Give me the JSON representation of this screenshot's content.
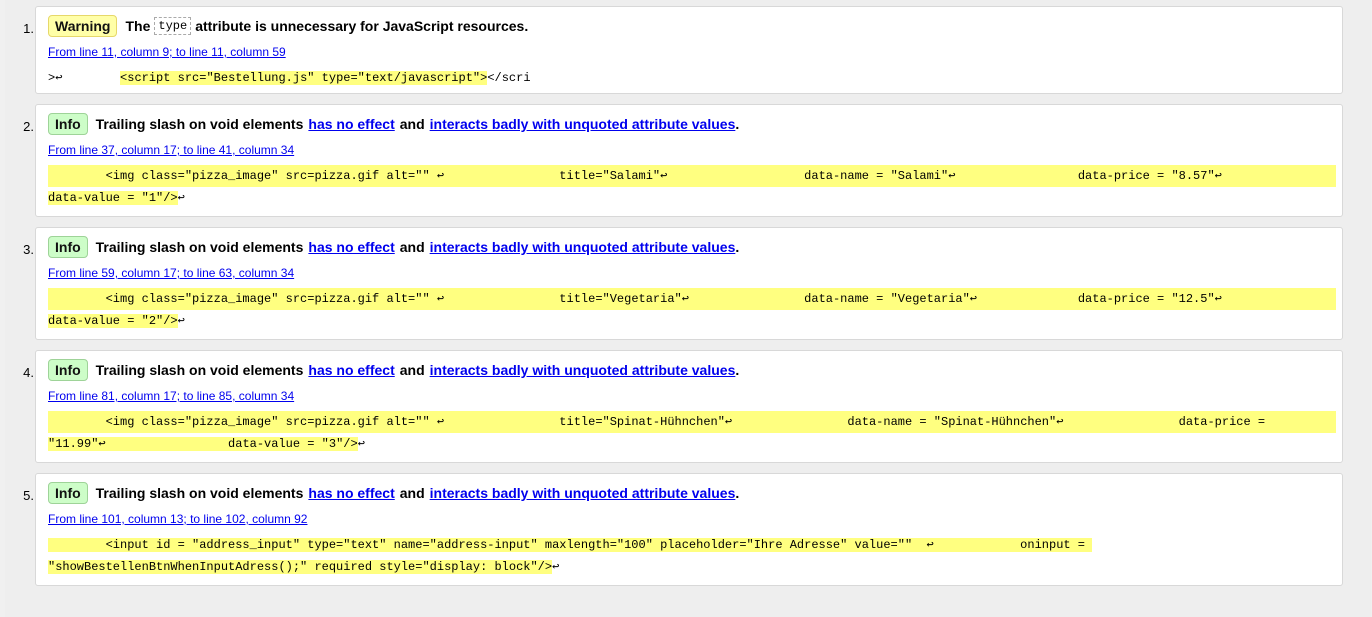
{
  "messages": [
    {
      "num": "1.",
      "type": "Warning",
      "text_before": "The",
      "code": "type",
      "text_after": "attribute is unnecessary for JavaScript resources.",
      "location": "From line 11, column 9; to line 11, column 59",
      "line1_pre": ">↩",
      "line1_hl": "<script src=\"Bestellung.js\" type=\"text/javascript\">",
      "line1_post": "</scri",
      "line2_hl": "",
      "line2_post": ""
    },
    {
      "num": "2.",
      "type": "Info",
      "text_before": "Trailing slash on void elements",
      "link1": "has no effect",
      "middle": "and",
      "link2": "interacts badly with unquoted attribute values",
      "end": ".",
      "location": "From line 37, column 17; to line 41, column 34",
      "line1_pre": "",
      "line1_hl": "        <img class=\"pizza_image\" src=pizza.gif alt=\"\" ↩                title=\"Salami\"↩                   data-name = \"Salami\"↩                 data-price = \"8.57\"↩ ",
      "line1_post": "",
      "line2_hl": "data-value = \"1\"/>",
      "line2_post": "↩"
    },
    {
      "num": "3.",
      "type": "Info",
      "text_before": "Trailing slash on void elements",
      "link1": "has no effect",
      "middle": "and",
      "link2": "interacts badly with unquoted attribute values",
      "end": ".",
      "location": "From line 59, column 17; to line 63, column 34",
      "line1_pre": "",
      "line1_hl": "        <img class=\"pizza_image\" src=pizza.gif alt=\"\" ↩                title=\"Vegetaria\"↩                data-name = \"Vegetaria\"↩              data-price = \"12.5\"↩ ",
      "line1_post": "",
      "line2_hl": "data-value = \"2\"/>",
      "line2_post": "↩"
    },
    {
      "num": "4.",
      "type": "Info",
      "text_before": "Trailing slash on void elements",
      "link1": "has no effect",
      "middle": "and",
      "link2": "interacts badly with unquoted attribute values",
      "end": ".",
      "location": "From line 81, column 17; to line 85, column 34",
      "line1_pre": "",
      "line1_hl": "        <img class=\"pizza_image\" src=pizza.gif alt=\"\" ↩                title=\"Spinat-Hühnchen\"↩                data-name = \"Spinat-Hühnchen\"↩                data-price = ",
      "line1_post": "",
      "line2_hl": "\"11.99\"↩                 data-value = \"3\"/>",
      "line2_post": "↩"
    },
    {
      "num": "5.",
      "type": "Info",
      "text_before": "Trailing slash on void elements",
      "link1": "has no effect",
      "middle": "and",
      "link2": "interacts badly with unquoted attribute values",
      "end": ".",
      "location": "From line 101, column 13; to line 102, column 92",
      "line1_pre": "",
      "line1_hl": "        <input id = \"address_input\" type=\"text\" name=\"address-input\" maxlength=\"100\" placeholder=\"Ihre Adresse\" value=\"\"  ↩            oninput = ",
      "line1_post": "",
      "line2_hl": "\"showBestellenBtnWhenInputAdress();\" required style=\"display: block\"/>",
      "line2_post": "↩"
    }
  ],
  "colors": {
    "warning_bg": "#ffffa8",
    "info_bg": "#cdfdc8",
    "highlight": "#ffff80",
    "link": "#0000ee"
  }
}
